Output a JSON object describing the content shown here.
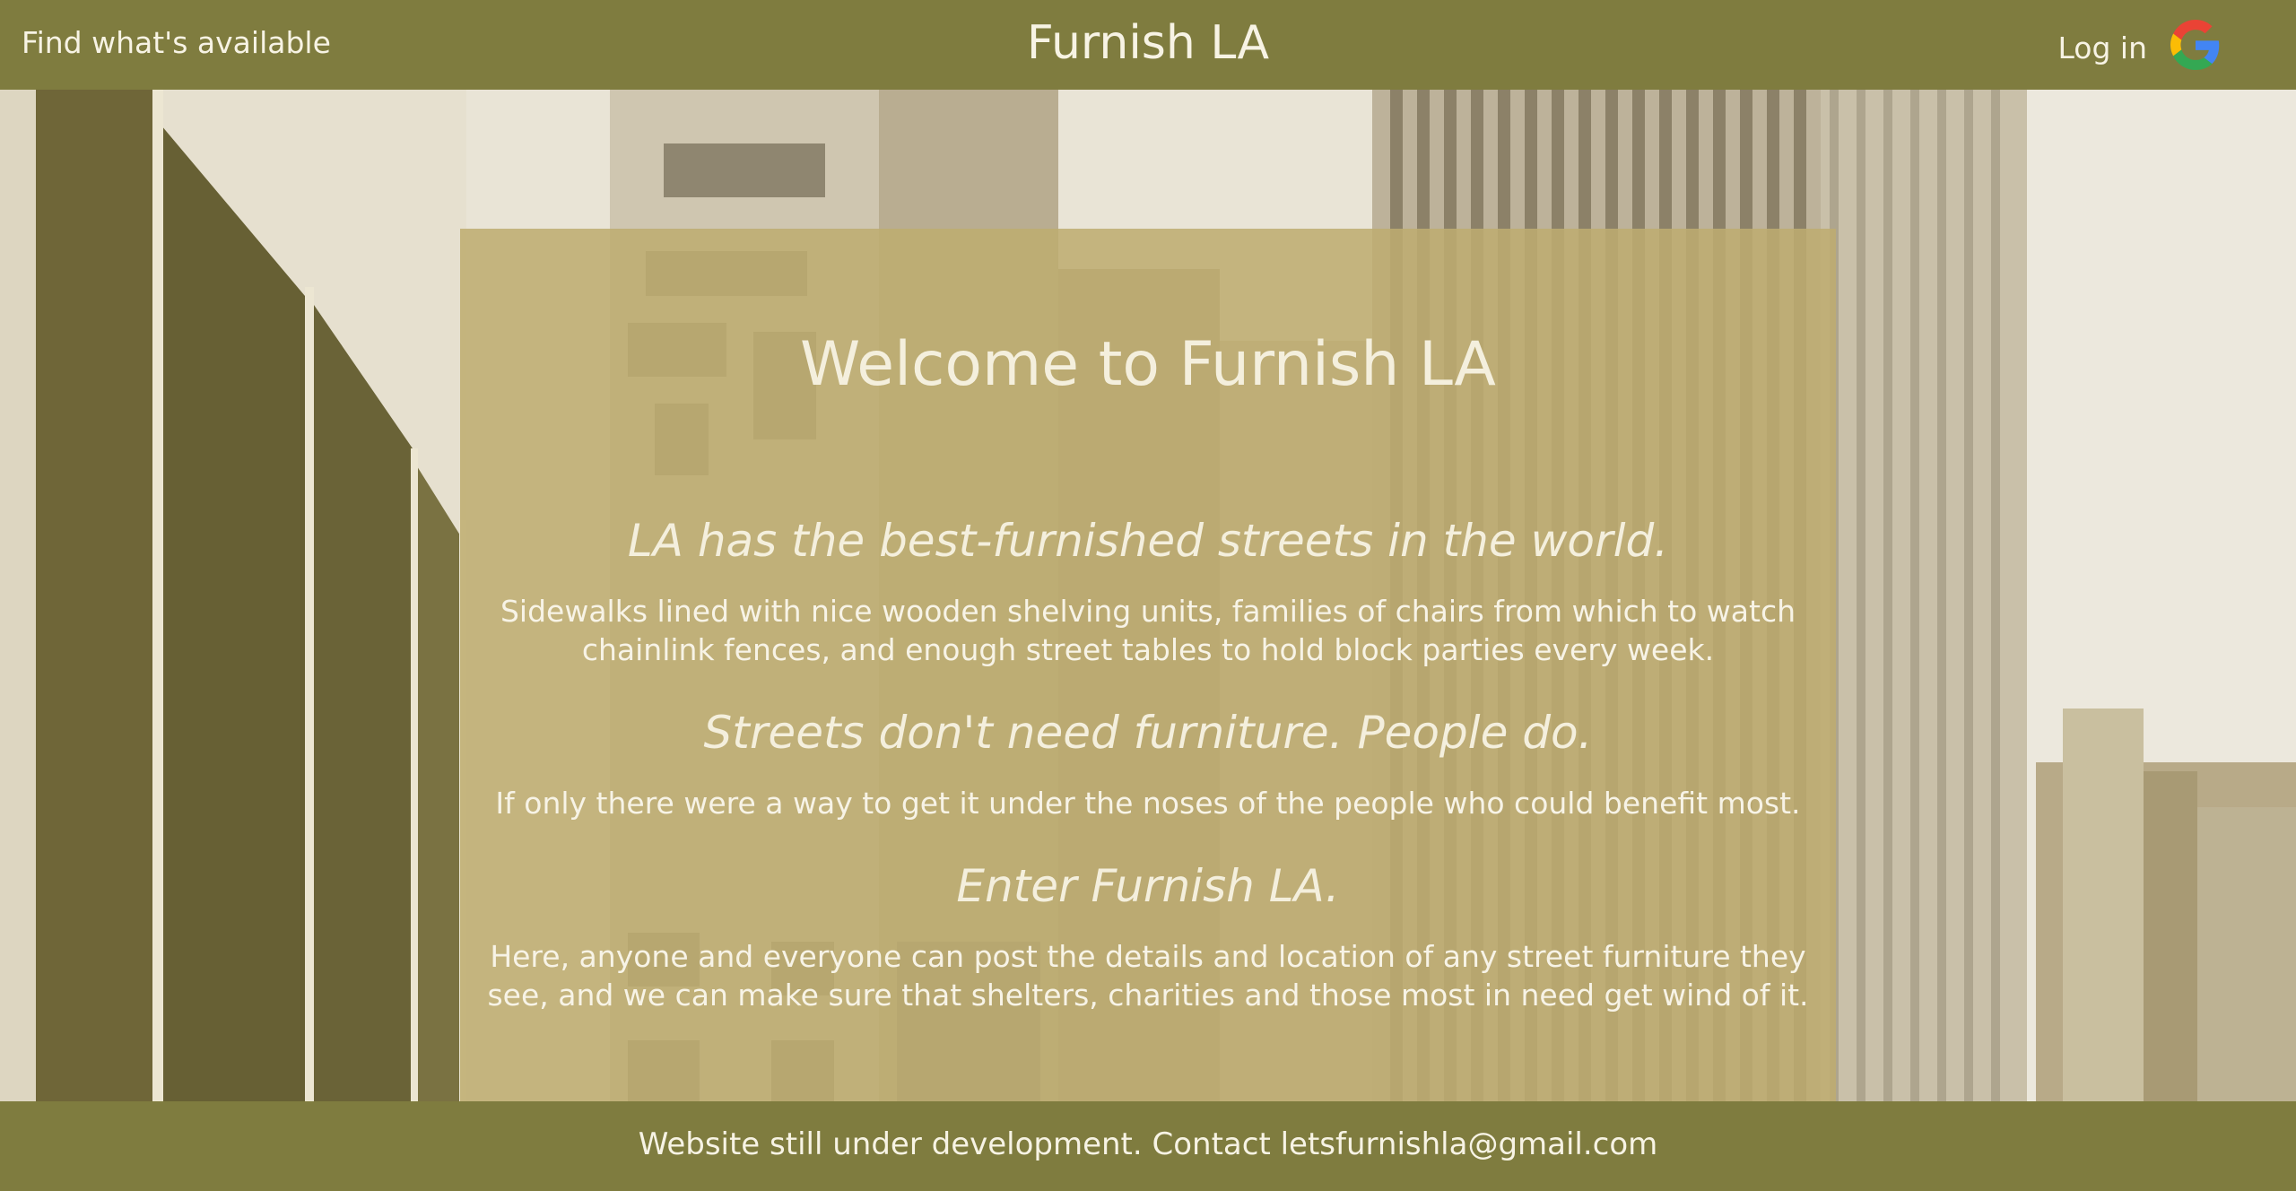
{
  "header": {
    "left_link": "Find what's available",
    "title": "Furnish LA",
    "login": "Log in"
  },
  "hero": {
    "heading": "Welcome to Furnish LA",
    "section1_heading": "LA has the best-furnished streets in the world.",
    "section1_text": "Sidewalks lined with nice wooden shelving units, families of chairs from which to watch chainlink fences, and enough street tables to hold block parties every week.",
    "section2_heading": "Streets don't need furniture. People do.",
    "section2_text": "If only there were a way to get it under the noses of the people who could benefit most.",
    "section3_heading": "Enter Furnish LA.",
    "section3_text": "Here, anyone and everyone can post the details and location of any street furniture they see, and we can make sure that shelters, charities and those most in need get wind of it."
  },
  "footer": {
    "text": "Website still under development. Contact letsfurnishla@gmail.com"
  },
  "colors": {
    "bar": "#7f7c3f",
    "panel": "#bfac70",
    "text": "#f4efdd"
  },
  "icons": {
    "login": "google-icon"
  }
}
